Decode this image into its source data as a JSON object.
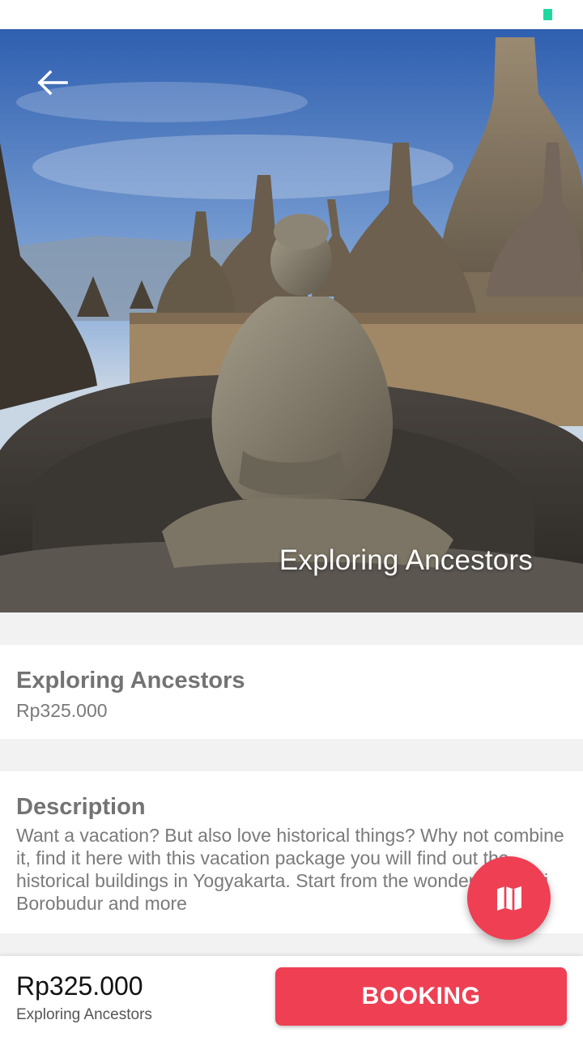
{
  "colors": {
    "accent": "#ee3f53",
    "status_indicator": "#1fd8a0",
    "text_muted": "#737373",
    "background": "#f2f2f2"
  },
  "header": {
    "back_icon": "arrow-left-icon",
    "hero_title": "Exploring Ancestors"
  },
  "package": {
    "title": "Exploring Ancestors",
    "price": "Rp325.000"
  },
  "description": {
    "heading": "Description",
    "text": "Want a vacation? But also love historical things? Why not combine it, find it here with this vacation package you will find out the historical buildings in Yogyakarta. Start from the wonderful Candi Borobudur and more"
  },
  "fab": {
    "icon": "map-icon"
  },
  "bottom_bar": {
    "price": "Rp325.000",
    "name": "Exploring Ancestors",
    "booking_label": "BOOKING"
  }
}
